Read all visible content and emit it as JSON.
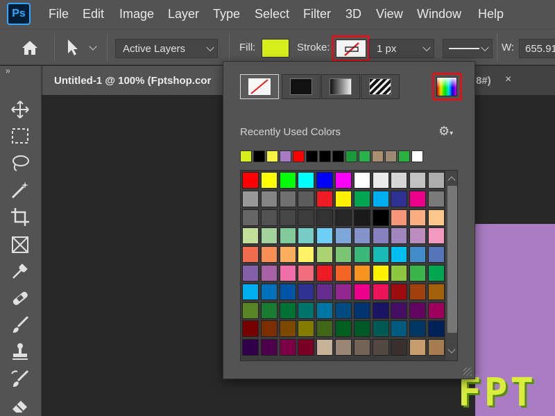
{
  "app": {
    "logo_text": "Ps"
  },
  "menu": [
    "File",
    "Edit",
    "Image",
    "Layer",
    "Type",
    "Select",
    "Filter",
    "3D",
    "View",
    "Window",
    "Help"
  ],
  "options": {
    "sample_select": "Active Layers",
    "fill_label": "Fill:",
    "fill_color": "#d6ee1c",
    "stroke_label": "Stroke:",
    "stroke_width": "1 px",
    "width_label": "W:",
    "width_value": "655.91"
  },
  "tabs": {
    "active_title": "Untitled-1 @ 100% (Fptshop.cor",
    "second_partial": "8#)",
    "close_glyph": "×"
  },
  "toolbar_collapse": "»",
  "popup": {
    "recent_label": "Recently Used Colors",
    "gear_glyph": "⚙",
    "recent_colors": [
      "#d6ee1c",
      "#000000",
      "#f5f542",
      "#a87cc5",
      "#ff0000",
      "#000000",
      "#000000",
      "#000000",
      "#1a9a3a",
      "#27b34a",
      "#a89070",
      "#9c8a74",
      "#2bb040",
      "#ffffff"
    ],
    "swatch_rows": [
      [
        "#ff0000",
        "#ffff00",
        "#00ff00",
        "#00ffff",
        "#0000ff",
        "#ff00ff",
        "#ffffff",
        "#ebebeb",
        "#d6d6d6",
        "#c2c2c2",
        "#adadad"
      ],
      [
        "#999999",
        "#858585",
        "#707070",
        "#5c5c5c",
        "#ed1c24",
        "#fff200",
        "#00a651",
        "#00aeef",
        "#2e3192",
        "#ec008c",
        "#7a7a7a"
      ],
      [
        "#666666",
        "#525252",
        "#474747",
        "#3d3d3d",
        "#333333",
        "#262626",
        "#1a1a1a",
        "#000000",
        "#f69679",
        "#f9ad81",
        "#fdc68a"
      ],
      [
        "#c4df9b",
        "#a3d39c",
        "#82ca9c",
        "#7accc8",
        "#6dcff6",
        "#7da7d9",
        "#8393ca",
        "#8781bd",
        "#a186be",
        "#bd8cbf",
        "#f49ac1"
      ],
      [
        "#f26c4f",
        "#f68e55",
        "#fbaf5c",
        "#fff467",
        "#acd372",
        "#7cc576",
        "#3bb878",
        "#1abbb4",
        "#00bff3",
        "#438ccb",
        "#5574b9"
      ],
      [
        "#8560a8",
        "#a863a8",
        "#f06eaa",
        "#f26d7d",
        "#ed1c24",
        "#f26522",
        "#f7941d",
        "#fff200",
        "#8dc63f",
        "#39b54a",
        "#00a651"
      ],
      [
        "#00aeef",
        "#0072bc",
        "#0054a6",
        "#2e3192",
        "#662d91",
        "#92278f",
        "#ec008c",
        "#ed145b",
        "#9e0b0f",
        "#a0410d",
        "#a36209"
      ],
      [
        "#598527",
        "#197b30",
        "#007236",
        "#00746b",
        "#0076a3",
        "#004a80",
        "#003471",
        "#1b1464",
        "#440e62",
        "#630460",
        "#9e005d"
      ],
      [
        "#790000",
        "#7b2e00",
        "#7d4900",
        "#827b00",
        "#406618",
        "#005e20",
        "#005826",
        "#005952",
        "#005b7f",
        "#003663",
        "#002157"
      ],
      [
        "#32004b",
        "#4b0049",
        "#7b0046",
        "#7a0026",
        "#c7b299",
        "#998675",
        "#736357",
        "#534741",
        "#37302d",
        "#c69c6d",
        "#a67c52"
      ]
    ]
  }
}
